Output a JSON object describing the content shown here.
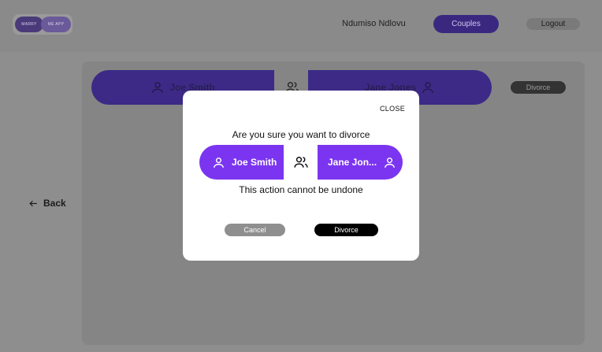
{
  "header": {
    "logo_left": "MARRY",
    "logo_right": "ME APP",
    "user_name": "Ndumiso Ndlovu",
    "couples_label": "Couples",
    "logout_label": "Logout"
  },
  "background": {
    "partner_left": "Joe Smith",
    "partner_right": "Jane Jones",
    "divorce_label": "Divorce",
    "back_label": "Back"
  },
  "modal": {
    "close_label": "CLOSE",
    "question": "Are you sure you want to divorce",
    "partner_left": "Joe Smith",
    "partner_right": "Jane Jon...",
    "warning": "This action cannot be undone",
    "cancel_label": "Cancel",
    "divorce_label": "Divorce"
  },
  "icons": {
    "person": "person-icon",
    "couple": "users-icon",
    "back": "arrow-left-icon"
  },
  "colors": {
    "accent": "#7b35f0",
    "overlay_accent": "#3c2a86",
    "primary_button": "#000000",
    "secondary_button": "#8f8f8f"
  }
}
